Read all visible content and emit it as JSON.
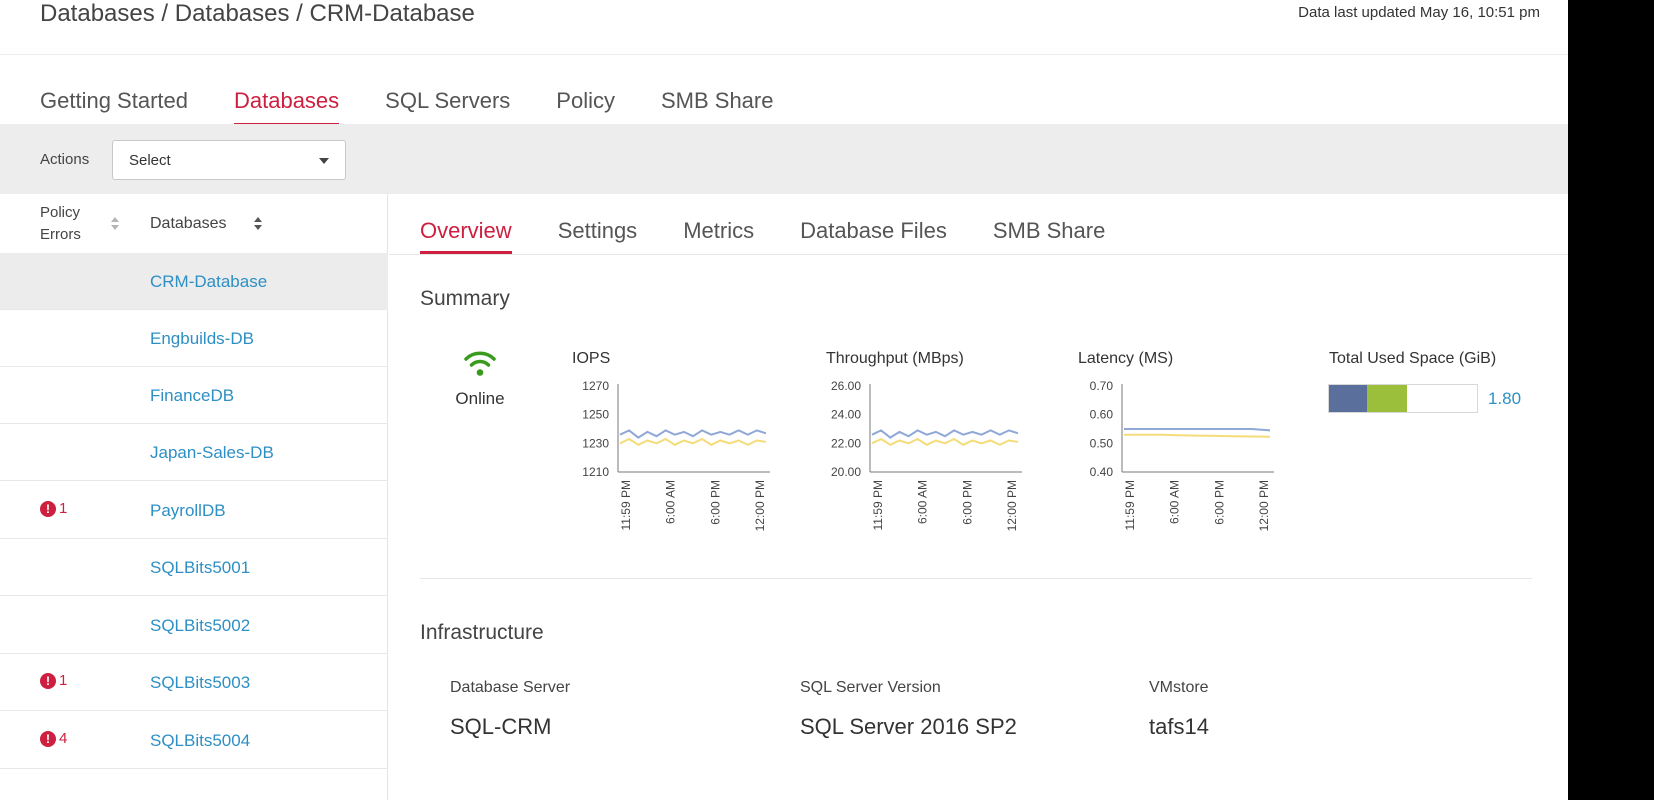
{
  "header": {
    "breadcrumb": "Databases / Databases / CRM-Database",
    "last_updated": "Data last updated May 16, 10:51 pm"
  },
  "top_tabs": [
    {
      "label": "Getting Started",
      "active": false
    },
    {
      "label": "Databases",
      "active": true
    },
    {
      "label": "SQL Servers",
      "active": false
    },
    {
      "label": "Policy",
      "active": false
    },
    {
      "label": "SMB Share",
      "active": false
    }
  ],
  "actions": {
    "label": "Actions",
    "select_value": "Select"
  },
  "list": {
    "col_policy": "Policy Errors",
    "col_policy_line1": "Policy",
    "col_policy_line2": "Errors",
    "col_databases": "Databases",
    "rows": [
      {
        "name": "CRM-Database",
        "errors": "",
        "selected": true
      },
      {
        "name": "Engbuilds-DB",
        "errors": ""
      },
      {
        "name": "FinanceDB",
        "errors": ""
      },
      {
        "name": "Japan-Sales-DB",
        "errors": ""
      },
      {
        "name": "PayrollDB",
        "errors": "1"
      },
      {
        "name": "SQLBits5001",
        "errors": ""
      },
      {
        "name": "SQLBits5002",
        "errors": ""
      },
      {
        "name": "SQLBits5003",
        "errors": "1"
      },
      {
        "name": "SQLBits5004",
        "errors": "4"
      }
    ]
  },
  "sub_tabs": [
    {
      "label": "Overview",
      "active": true
    },
    {
      "label": "Settings",
      "active": false
    },
    {
      "label": "Metrics",
      "active": false
    },
    {
      "label": "Database Files",
      "active": false
    },
    {
      "label": "SMB Share",
      "active": false
    }
  ],
  "summary": {
    "title": "Summary",
    "status": "Online",
    "total_space": {
      "title": "Total Used Space (GiB)",
      "value": "1.80",
      "segments": [
        {
          "fraction": 0.26,
          "color": "#5a6f9c"
        },
        {
          "fraction": 0.27,
          "color": "#9bbf3a"
        }
      ]
    }
  },
  "chart_data": [
    {
      "type": "line",
      "title": "IOPS",
      "x": [
        "11:59 PM",
        "6:00 AM",
        "6:00 PM",
        "12:00 PM"
      ],
      "yticks": [
        "1270",
        "1250",
        "1230",
        "1210"
      ],
      "ylim": [
        1210,
        1270
      ],
      "series": [
        {
          "color": "#8fa8d6",
          "values": [
            1236,
            1239,
            1234,
            1238,
            1235,
            1239,
            1236,
            1238,
            1235,
            1239,
            1236,
            1238,
            1236,
            1239,
            1236,
            1239,
            1237
          ]
        },
        {
          "color": "#f5dc7a",
          "values": [
            1230,
            1233,
            1229,
            1232,
            1230,
            1233,
            1229,
            1232,
            1230,
            1233,
            1229,
            1232,
            1230,
            1232,
            1229,
            1232,
            1231
          ]
        }
      ]
    },
    {
      "type": "line",
      "title": "Throughput (MBps)",
      "x": [
        "11:59 PM",
        "6:00 AM",
        "6:00 PM",
        "12:00 PM"
      ],
      "yticks": [
        "26.00",
        "24.00",
        "22.00",
        "20.00"
      ],
      "ylim": [
        20,
        26
      ],
      "series": [
        {
          "color": "#8fa8d6",
          "values": [
            22.6,
            22.9,
            22.4,
            22.8,
            22.5,
            22.9,
            22.6,
            22.8,
            22.5,
            22.9,
            22.6,
            22.8,
            22.6,
            22.9,
            22.6,
            22.9,
            22.7
          ]
        },
        {
          "color": "#f5dc7a",
          "values": [
            22.0,
            22.3,
            21.9,
            22.2,
            22.0,
            22.3,
            21.9,
            22.2,
            22.0,
            22.3,
            21.9,
            22.2,
            22.0,
            22.2,
            21.9,
            22.2,
            22.1
          ]
        }
      ]
    },
    {
      "type": "line",
      "title": "Latency (MS)",
      "x": [
        "11:59 PM",
        "6:00 AM",
        "6:00 PM",
        "12:00 PM"
      ],
      "yticks": [
        "0.70",
        "0.60",
        "0.50",
        "0.40"
      ],
      "ylim": [
        0.4,
        0.7
      ],
      "series": [
        {
          "color": "#8fa8d6",
          "values": [
            0.55,
            0.55,
            0.55,
            0.55,
            0.55,
            0.55,
            0.55,
            0.55,
            0.545
          ]
        },
        {
          "color": "#f5dc7a",
          "values": [
            0.53,
            0.53,
            0.53,
            0.528,
            0.527,
            0.526,
            0.525,
            0.524,
            0.523
          ]
        }
      ]
    }
  ],
  "infrastructure": {
    "title": "Infrastructure",
    "fields": [
      {
        "label": "Database Server",
        "value": "SQL-CRM"
      },
      {
        "label": "SQL Server Version",
        "value": "SQL Server 2016 SP2"
      },
      {
        "label": "VMstore",
        "value": "tafs14"
      }
    ]
  },
  "colors": {
    "accent": "#cd1f3f",
    "link": "#2d8fc4",
    "online": "#3a9a1e"
  }
}
